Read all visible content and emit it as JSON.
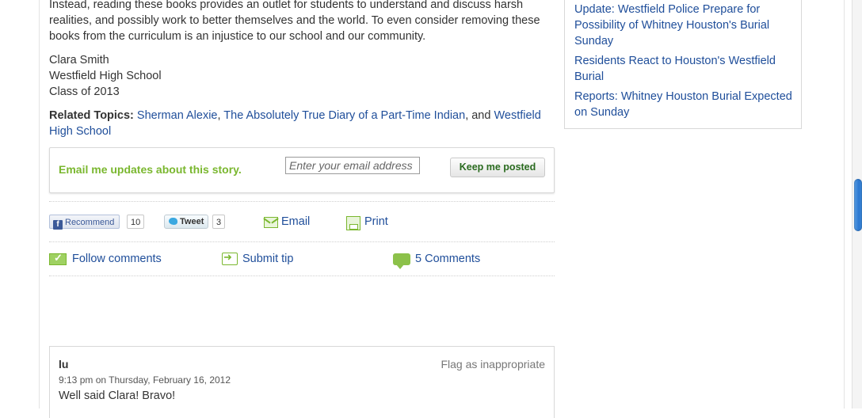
{
  "article": {
    "body_text": "Instead, reading these books provides an outlet for students to understand and discuss harsh realities, and possibly work to better themselves and the world. To even consider removing these books from the curriculum is an injustice to our school and our community.",
    "signature": {
      "name": "Clara Smith",
      "school": "Westfield High School",
      "class": "Class of 2013"
    },
    "related": {
      "label": "Related Topics:",
      "topic_1": "Sherman Alexie",
      "sep_1": ", ",
      "topic_2": "The Absolutely True Diary of a Part-Time Indian",
      "sep_2": ", and ",
      "topic_3": "Westfield High School"
    }
  },
  "email_signup": {
    "label": "Email me updates about this story.",
    "placeholder": "Enter your email address",
    "button": "Keep me posted"
  },
  "share": {
    "facebook_label": "Recommend",
    "facebook_count": "10",
    "twitter_label": "Tweet",
    "twitter_count": "3",
    "email_label": "Email",
    "print_label": "Print"
  },
  "actions": {
    "follow_label": "Follow comments",
    "submit_tip_label": "Submit tip",
    "comments_label": "5 Comments"
  },
  "comment": {
    "author": "lu",
    "flag_label": "Flag as inappropriate",
    "timestamp": "9:13 pm on Thursday, February 16, 2012",
    "text": "Well said Clara! Bravo!"
  },
  "sidebar": {
    "links": [
      "Update: Westfield Police Prepare for Possibility of Whitney Houston's Burial Sunday",
      "Residents React to Houston's Westfield Burial",
      "Reports: Whitney Houston Burial Expected on Sunday"
    ]
  },
  "colors": {
    "link": "#1f4e9a",
    "accent_green": "#7ab72f",
    "text": "#333333"
  }
}
